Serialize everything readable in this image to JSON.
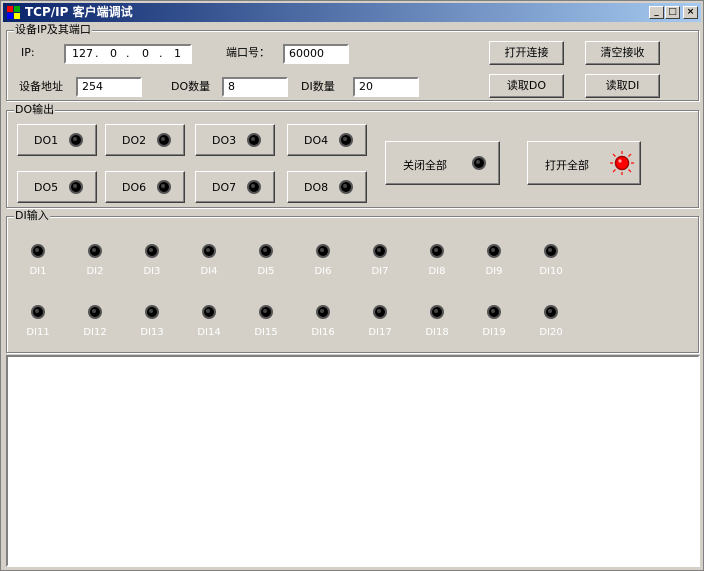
{
  "window": {
    "title": "TCP/IP 客户端调试"
  },
  "title_buttons": {
    "minimize": "_",
    "maximize": "□",
    "close": "×"
  },
  "colors": {
    "led_on": "#ff0000",
    "led_off": "#000000",
    "title_start": "#0a246a",
    "title_end": "#a6caf0"
  },
  "connection": {
    "group_title": "设备IP及其端口",
    "ip_label": "IP:",
    "ip_octets": [
      "127",
      "0",
      "0",
      "1"
    ],
    "port_label": "端口号：",
    "port_value": "60000",
    "addr_label": "设备地址",
    "addr_value": "254",
    "do_count_label": "DO数量",
    "do_count_value": "8",
    "di_count_label": "DI数量",
    "di_count_value": "20",
    "open_button": "打开连接",
    "clear_button": "清空接收",
    "read_do_button": "读取DO",
    "read_di_button": "读取DI"
  },
  "do_output": {
    "group_title": "DO输出",
    "buttons": [
      "DO1",
      "DO2",
      "DO3",
      "DO4",
      "DO5",
      "DO6",
      "DO7",
      "DO8"
    ],
    "close_all": "关闭全部",
    "open_all": "打开全部",
    "open_all_indicator": "on"
  },
  "di_input": {
    "group_title": "DI输入",
    "labels": [
      "DI1",
      "DI2",
      "DI3",
      "DI4",
      "DI5",
      "DI6",
      "DI7",
      "DI8",
      "DI9",
      "DI10",
      "DI11",
      "DI12",
      "DI13",
      "DI14",
      "DI15",
      "DI16",
      "DI17",
      "DI18",
      "DI19",
      "DI20"
    ]
  },
  "receive_area": {
    "content": ""
  }
}
